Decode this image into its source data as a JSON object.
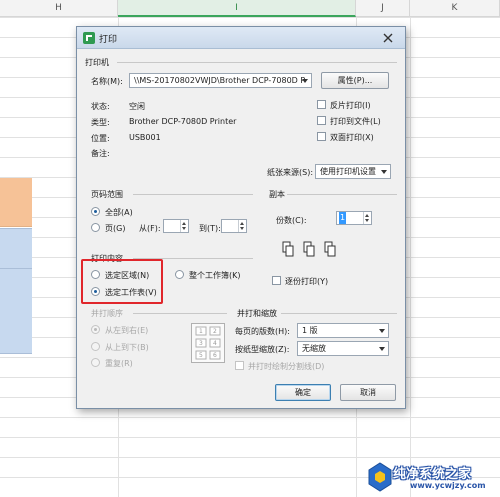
{
  "sheet": {
    "columns": [
      "H",
      "I",
      "J",
      "K"
    ],
    "selected_column": "I"
  },
  "dialog": {
    "title": "打印",
    "printer": {
      "group_title": "打印机",
      "name_label": "名称(M):",
      "name_value": "\\\\MS-20170802VWJD\\Brother DCP-7080D P",
      "properties_button": "属性(P)...",
      "status_label": "状态:",
      "status_value": "空闲",
      "type_label": "类型:",
      "type_value": "Brother DCP-7080D Printer",
      "location_label": "位置:",
      "location_value": "USB001",
      "comment_label": "备注:",
      "comment_value": "",
      "reverse_print": "反片打印(I)",
      "print_to_file": "打印到文件(L)",
      "duplex": "双面打印(X)",
      "paper_source_label": "纸张来源(S):",
      "paper_source_value": "使用打印机设置"
    },
    "page_range": {
      "group_title": "页码范围",
      "all": "全部(A)",
      "pages": "页(G)",
      "from_label": "从(F):",
      "to_label": "到(T):"
    },
    "copies": {
      "group_title": "副本",
      "count_label": "份数(C):",
      "count_value": "1",
      "collate": "逐份打印(Y)"
    },
    "print_content": {
      "group_title": "打印内容",
      "selection": "选定区域(N)",
      "whole_workbook": "整个工作簿(K)",
      "selected_sheets": "选定工作表(V)"
    },
    "print_order": {
      "group_title": "并打顺序",
      "left_to_right": "从左到右(E)",
      "top_to_bottom": "从上到下(B)",
      "repeat": "重复(R)"
    },
    "scaling": {
      "group_title": "并打和缩放",
      "pages_per_sheet_label": "每页的版数(H):",
      "pages_per_sheet_value": "1 版",
      "scale_to_paper_label": "按纸型缩放(Z):",
      "scale_to_paper_value": "无缩放",
      "draw_borders": "并打时绘制分割线(D)"
    },
    "ok_button": "确定",
    "cancel_button": "取消"
  },
  "watermark": {
    "text": "纯净系统之家",
    "url": "www.ycwjzy.com"
  },
  "colors": {
    "highlight_red": "#e0262b",
    "accent_green": "#3ba55c"
  }
}
